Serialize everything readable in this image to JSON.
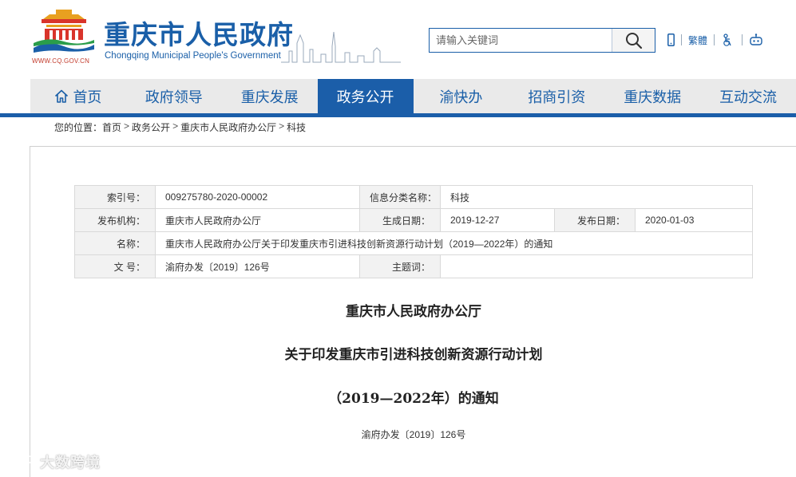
{
  "header": {
    "site_title": "重庆市人民政府",
    "site_subtitle": "Chongqing Municipal People's Government",
    "site_url": "WWW.CQ.GOV.CN",
    "search": {
      "placeholder": "请输入关键词"
    },
    "tools": {
      "mobile_icon": "mobile-icon",
      "traditional_label": "繁體",
      "accessibility_icon": "accessibility-icon",
      "robot_icon": "robot-icon"
    }
  },
  "nav": {
    "items": [
      {
        "label": "首页",
        "icon": "home-icon"
      },
      {
        "label": "政府领导"
      },
      {
        "label": "重庆发展"
      },
      {
        "label": "政务公开",
        "active": true
      },
      {
        "label": "渝快办"
      },
      {
        "label": "招商引资"
      },
      {
        "label": "重庆数据"
      },
      {
        "label": "互动交流"
      }
    ]
  },
  "breadcrumb": {
    "prefix": "您的位置：",
    "items": [
      "首页",
      "政务公开",
      "重庆市人民政府办公厅",
      "科技"
    ],
    "separator": ">"
  },
  "info": {
    "index_label": "索引号：",
    "index_value": "009275780-2020-00002",
    "category_label": "信息分类名称：",
    "category_value": "科技",
    "publisher_label": "发布机构：",
    "publisher_value": "重庆市人民政府办公厅",
    "created_label": "生成日期：",
    "created_value": "2019-12-27",
    "published_label": "发布日期：",
    "published_value": "2020-01-03",
    "name_label": "名称：",
    "name_value": "重庆市人民政府办公厅关于印发重庆市引进科技创新资源行动计划（2019—2022年）的通知",
    "docno_label": "文 号：",
    "docno_value": "渝府办发〔2019〕126号",
    "keywords_label": "主题词：",
    "keywords_value": ""
  },
  "document": {
    "title_line1": "重庆市人民政府办公厅",
    "title_line2": "关于印发重庆市引进科技创新资源行动计划",
    "title_line3": "（2019—2022年）的通知",
    "doc_number": "渝府办发〔2019〕126号"
  },
  "watermark": "大数跨境",
  "colors": {
    "brand_blue": "#1b5ea9",
    "brand_red": "#d9342b",
    "nav_bg": "#eaeaea"
  }
}
